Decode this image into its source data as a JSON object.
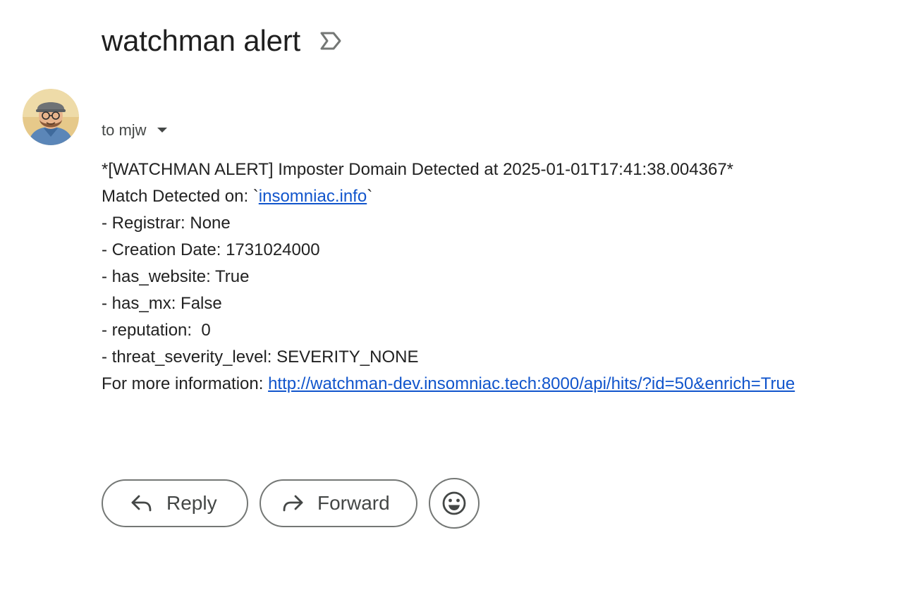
{
  "email": {
    "subject": "watchman alert",
    "label_icon": "label-arrow-icon",
    "avatar_icon": "sender-avatar",
    "recipient": "to mjw",
    "body": {
      "line1": "*[WATCHMAN ALERT] Imposter Domain Detected at 2025-01-01T17:41:38.004367*",
      "match_prefix": "Match Detected on: `",
      "match_link": "insomniac.info",
      "match_suffix": "`",
      "registrar": "- Registrar: None",
      "creation_date": "- Creation Date: 1731024000",
      "has_website": "- has_website: True",
      "has_mx": "- has_mx: False",
      "reputation": "- reputation:  0",
      "threat_level": "- threat_severity_level: SEVERITY_NONE",
      "more_info_prefix": "For more information: ",
      "more_info_link": "http://watchman-dev.insomniac.tech:8000/api/hits/?id=50&enrich=True"
    }
  },
  "actions": {
    "reply_label": "Reply",
    "forward_label": "Forward",
    "reply_icon": "reply-icon",
    "forward_icon": "forward-icon",
    "emoji_icon": "emoji-icon"
  },
  "colors": {
    "link": "#1155cc",
    "text": "#222222",
    "muted": "#444746",
    "button_border": "#747775"
  }
}
